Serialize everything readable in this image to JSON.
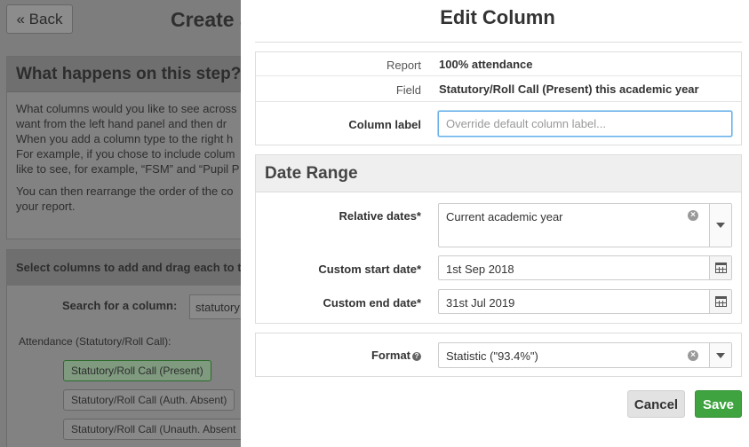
{
  "background": {
    "back_button": "« Back",
    "page_title": "Create a",
    "help_panel": {
      "title": "What happens on this step?",
      "paragraphs": [
        "What columns would you like to see across",
        "want from the left hand panel and then dr",
        "When you add a column type to the right h",
        "For example, if you chose to include colum",
        "like to see, for example, “FSM” and “Pupil P",
        "You can then rearrange the order of the co",
        "your report."
      ]
    },
    "columns_panel": {
      "title": "Select columns to add and drag each to the",
      "search_label": "Search for a column:",
      "search_value": "statutory",
      "group_label": "Attendance (Statutory/Roll Call):",
      "chips": [
        "Statutory/Roll Call (Present)",
        "Statutory/Roll Call (Auth. Absent)",
        "Statutory/Roll Call (Unauth. Absent"
      ]
    }
  },
  "modal": {
    "title": "Edit Column",
    "report_label": "Report",
    "report_value": "100% attendance",
    "field_label": "Field",
    "field_value": "Statutory/Roll Call (Present) this academic year",
    "column_label_label": "Column label",
    "column_label_placeholder": "Override default column label...",
    "date_range": {
      "title": "Date Range",
      "relative_label": "Relative dates*",
      "relative_value": "Current academic year",
      "start_label": "Custom start date*",
      "start_value": "1st Sep 2018",
      "end_label": "Custom end date*",
      "end_value": "31st Jul 2019"
    },
    "format_label": "Format",
    "format_value": "Statistic (\"93.4%\")",
    "cancel_label": "Cancel",
    "save_label": "Save"
  }
}
